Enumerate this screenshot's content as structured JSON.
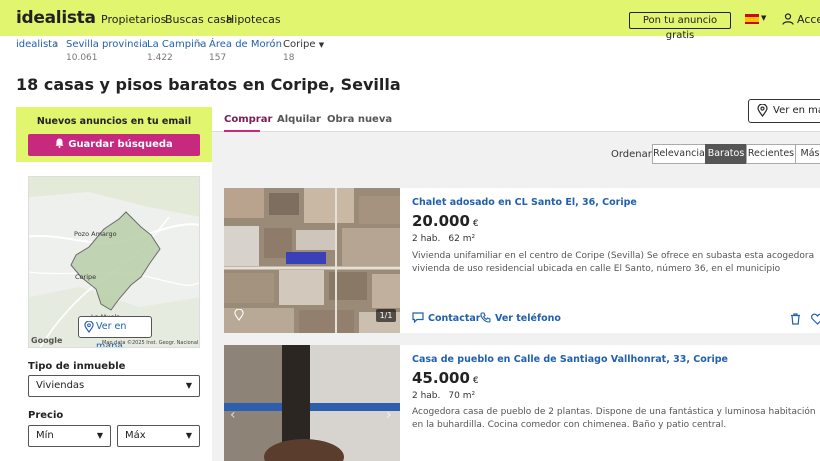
{
  "header": {
    "logo": "idealista",
    "nav": [
      "Propietarios",
      "Buscas casa",
      "Hipotecas"
    ],
    "publish": "Pon tu anuncio gratis",
    "login": "Acceder"
  },
  "breadcrumb": [
    {
      "label": "idealista",
      "count": ""
    },
    {
      "label": "Sevilla provincia",
      "count": "10.061"
    },
    {
      "label": "La Campiña",
      "count": "1.422"
    },
    {
      "label": "Área de Morón",
      "count": "157"
    },
    {
      "label": "Coripe",
      "count": "18"
    }
  ],
  "page_title": "18 casas y pisos baratos en Coripe, Sevilla",
  "map_button_top": "Ver en mapa",
  "alert": {
    "title": "Nuevos anuncios en tu email",
    "button": "Guardar búsqueda"
  },
  "map": {
    "labels": [
      "Pozo Amargo",
      "Coripe",
      "La Muela"
    ],
    "button": "Ver en mapa",
    "google": "Google",
    "attribution": "Map data ©2025 Inst. Geogr. Nacional"
  },
  "filters": {
    "type_label": "Tipo de inmueble",
    "type_value": "Viviendas",
    "price_label": "Precio",
    "min": "Mín",
    "max": "Máx"
  },
  "tabs": [
    "Comprar",
    "Alquilar",
    "Obra nueva"
  ],
  "order": {
    "label": "Ordenar:",
    "options": [
      "Relevancia",
      "Baratos",
      "Recientes",
      "Más"
    ],
    "selected": "Baratos"
  },
  "listings": [
    {
      "title": "Chalet adosado en CL Santo El, 36, Coripe",
      "price": "20.000",
      "currency": "€",
      "rooms": "2 hab.",
      "size": "62 m²",
      "description": "Vivienda unifamiliar en el centro de Coripe (Sevilla) Se ofrece en subasta esta acogedora vivienda de uso residencial ubicada en calle El Santo, número 36, en el municipio sevillano de Coripe. El inmueble ...",
      "photo_counter": "1/1",
      "contact": "Contactar",
      "phone": "Ver teléfono"
    },
    {
      "title": "Casa de pueblo en Calle de Santiago Vallhonrat, 33, Coripe",
      "price": "45.000",
      "currency": "€",
      "rooms": "2 hab.",
      "size": "70 m²",
      "description": "Acogedora casa de pueblo de 2 plantas. Dispone de una fantástica y luminosa habitación en la buhardilla. Cocina comedor con chimenea. Baño y patio central."
    }
  ],
  "colors": {
    "brand_yellow": "#e1f56e",
    "accent_magenta": "#c7297e",
    "link_blue": "#2160ae"
  }
}
